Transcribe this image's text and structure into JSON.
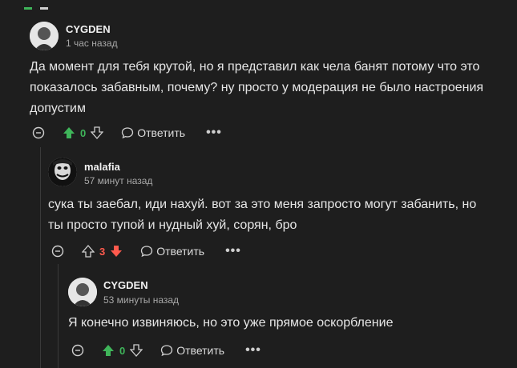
{
  "colors": {
    "background": "#1e1e1e",
    "upvote_active": "#3fb55a",
    "downvote_active": "#ff5a4d",
    "thread_line": "#3a3a3a"
  },
  "comments": [
    {
      "author": "CYGDEN",
      "time": "1 час назад",
      "text": "Да момент для тебя крутой, но я представил как чела банят потому что это\nпоказалось забавным, почему? ну просто у модерация не было настроения\nдопустим",
      "score": "0",
      "reply_label": "Ответить",
      "more_label": "•••",
      "vote_state": "up"
    },
    {
      "author": "malafia",
      "time": "57 минут назад",
      "text": "сука ты заебал, иди нахуй. вот за это меня запросто могут забанить, но\nты просто тупой и нудный хуй, сорян, бро",
      "score": "3",
      "reply_label": "Ответить",
      "more_label": "•••",
      "vote_state": "down"
    },
    {
      "author": "CYGDEN",
      "time": "53 минуты назад",
      "text": "Я конечно извиняюсь, но это уже прямое оскорбление",
      "score": "0",
      "reply_label": "Ответить",
      "more_label": "•••",
      "vote_state": "up"
    }
  ]
}
